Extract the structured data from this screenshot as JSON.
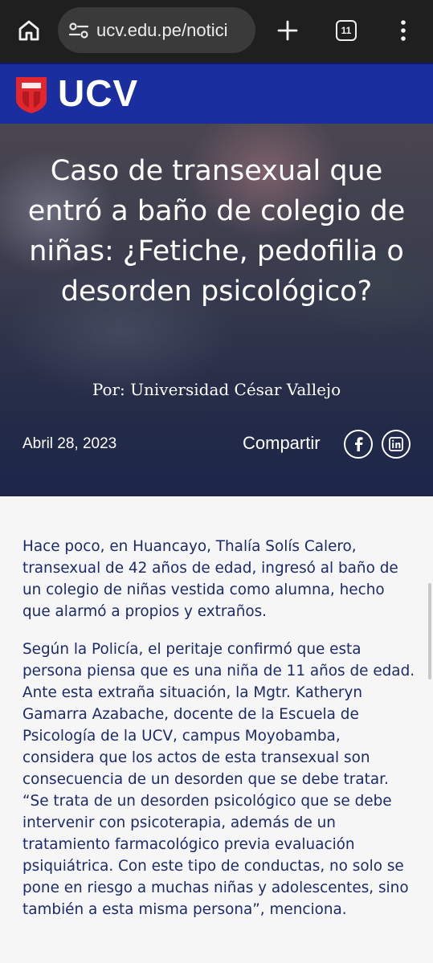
{
  "browser": {
    "url": "ucv.edu.pe/notici",
    "tab_count": "11",
    "icons": {
      "home": "home-icon",
      "site_settings": "tune-icon",
      "new_tab": "plus-icon",
      "tabs": "tab-switcher-icon",
      "menu": "more-vert-icon"
    }
  },
  "site": {
    "brand": "UCV",
    "header_color": "#1a2ea0",
    "logo_color": "#e1262d"
  },
  "hero": {
    "title": "Caso de transexual que entró a baño de colegio de niñas: ¿Fetiche, pedofilia o desorden psicológico?",
    "author": "Por: Universidad César Vallejo",
    "date": "Abril 28, 2023",
    "share_label": "Compartir",
    "share_icons": [
      "facebook-icon",
      "linkedin-icon"
    ]
  },
  "article": {
    "text_color": "#1c2a6a",
    "paragraphs": [
      "Hace poco, en Huancayo, Thalía Solís Calero, transexual de 42 años de edad, ingresó al baño de un colegio de niñas vestida como alumna, hecho que alarmó a propios y extraños.",
      "Según la Policía, el peritaje confirmó que esta persona piensa que es una niña de 11 años de edad. Ante esta extraña situación, la Mgtr. Katheryn Gamarra Azabache, docente de la Escuela de Psicología de la UCV, campus Moyobamba, considera que los actos de esta transexual son consecuencia de un desorden que se debe tratar. “Se trata de un desorden psicológico que se debe intervenir con psicoterapia, además de un tratamiento farmacológico previa evaluación psiquiátrica. Con este tipo de conductas, no solo se pone en riesgo a muchas niñas y adolescentes, sino también a esta misma persona”, menciona."
    ]
  }
}
